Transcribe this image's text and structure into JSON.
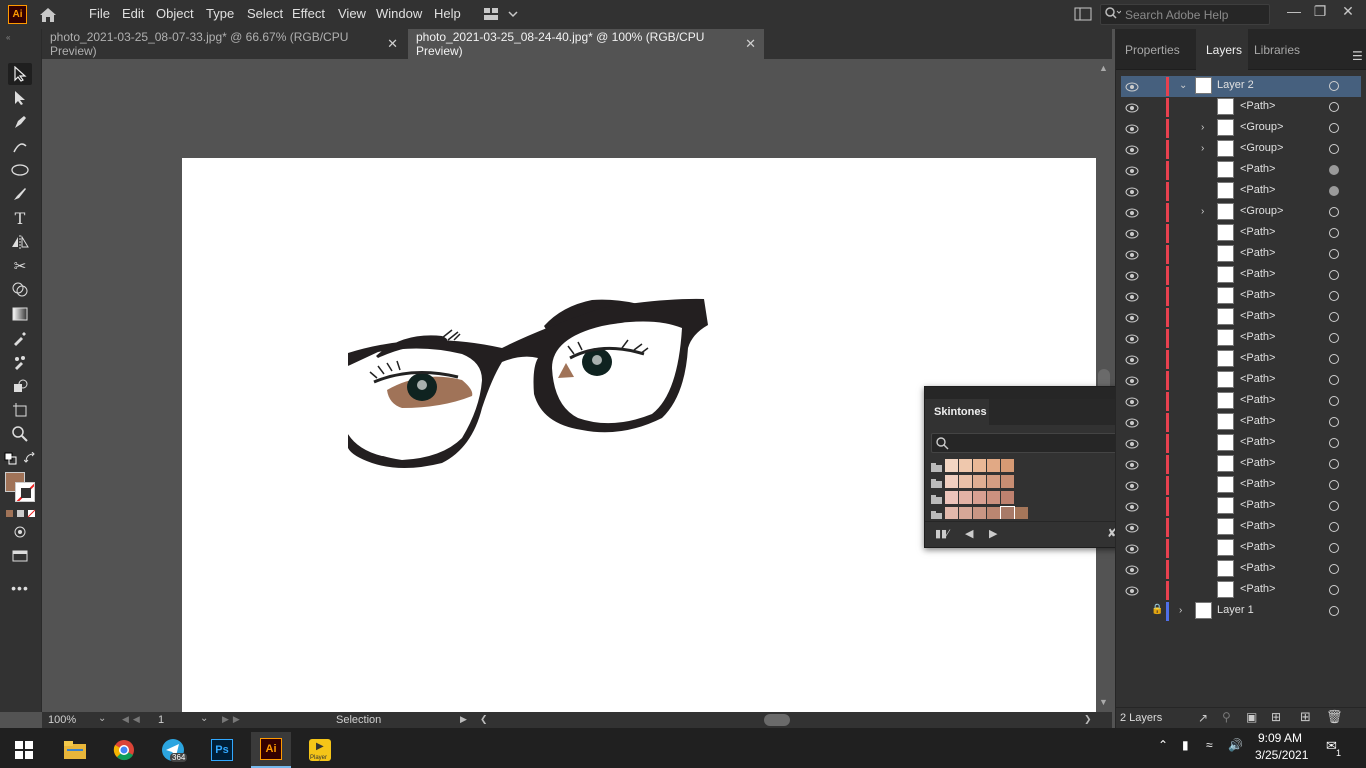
{
  "app": {
    "logo": "Ai",
    "menu": [
      "File",
      "Edit",
      "Object",
      "Type",
      "Select",
      "Effect",
      "View",
      "Window",
      "Help"
    ],
    "search_placeholder": "Search Adobe Help"
  },
  "tabs": [
    {
      "label": "photo_2021-03-25_08-07-33.jpg* @ 66.67% (RGB/CPU Preview)",
      "active": false
    },
    {
      "label": "photo_2021-03-25_08-24-40.jpg* @ 100% (RGB/CPU Preview)",
      "active": true
    }
  ],
  "status": {
    "zoom": "100%",
    "artboard": "1",
    "tool": "Selection"
  },
  "skintones": {
    "title": "Skintones",
    "rows": [
      [
        "#f3d6c3",
        "#efc8ad",
        "#e9b896",
        "#e1a985",
        "#d69a74"
      ],
      [
        "#f1cfc0",
        "#e9c0a8",
        "#dfae93",
        "#d49d82",
        "#c88e73"
      ],
      [
        "#edc4bb",
        "#e3b2a5",
        "#d8a092",
        "#cc917f",
        "#be816f"
      ],
      [
        "#e3b9ac",
        "#d6a797",
        "#c99684",
        "#bb8671",
        "#a87a68",
        "#a5765a"
      ]
    ]
  },
  "panel": {
    "tabs": [
      "Properties",
      "Layers",
      "Libraries"
    ],
    "active_tab": "Layers",
    "layers": [
      {
        "name": "Layer 2",
        "level": 0,
        "expanded": true,
        "selected": true,
        "target_filled": false
      },
      {
        "name": "<Path>",
        "level": 1,
        "target_filled": false
      },
      {
        "name": "<Group>",
        "level": 1,
        "has_children": true,
        "target_filled": false
      },
      {
        "name": "<Group>",
        "level": 1,
        "has_children": true,
        "target_filled": false
      },
      {
        "name": "<Path>",
        "level": 1,
        "target_filled": true
      },
      {
        "name": "<Path>",
        "level": 1,
        "target_filled": true
      },
      {
        "name": "<Group>",
        "level": 1,
        "has_children": true,
        "target_filled": false
      },
      {
        "name": "<Path>",
        "level": 1,
        "target_filled": false
      },
      {
        "name": "<Path>",
        "level": 1,
        "target_filled": false
      },
      {
        "name": "<Path>",
        "level": 1,
        "target_filled": false
      },
      {
        "name": "<Path>",
        "level": 1,
        "target_filled": false
      },
      {
        "name": "<Path>",
        "level": 1,
        "target_filled": false
      },
      {
        "name": "<Path>",
        "level": 1,
        "target_filled": false
      },
      {
        "name": "<Path>",
        "level": 1,
        "target_filled": false
      },
      {
        "name": "<Path>",
        "level": 1,
        "target_filled": false
      },
      {
        "name": "<Path>",
        "level": 1,
        "target_filled": false
      },
      {
        "name": "<Path>",
        "level": 1,
        "target_filled": false
      },
      {
        "name": "<Path>",
        "level": 1,
        "target_filled": false
      },
      {
        "name": "<Path>",
        "level": 1,
        "target_filled": false
      },
      {
        "name": "<Path>",
        "level": 1,
        "target_filled": false
      },
      {
        "name": "<Path>",
        "level": 1,
        "target_filled": false
      },
      {
        "name": "<Path>",
        "level": 1,
        "target_filled": false
      },
      {
        "name": "<Path>",
        "level": 1,
        "target_filled": false
      },
      {
        "name": "<Path>",
        "level": 1,
        "target_filled": false
      },
      {
        "name": "<Path>",
        "level": 1,
        "target_filled": false
      },
      {
        "name": "Layer 1",
        "level": 0,
        "expanded": false,
        "locked": true,
        "target_filled": false
      }
    ],
    "footer_label": "2 Layers"
  },
  "taskbar": {
    "time": "9:09 AM",
    "date": "3/25/2021",
    "telegram_badge": "364",
    "notification_count": "1",
    "ps_label": "Ps",
    "ai_label": "Ai",
    "player_label": "Player"
  },
  "colors": {
    "fill_swatch": "#a07358",
    "layer2_color": "#e8414f",
    "layer1_color": "#4f6fe8"
  }
}
